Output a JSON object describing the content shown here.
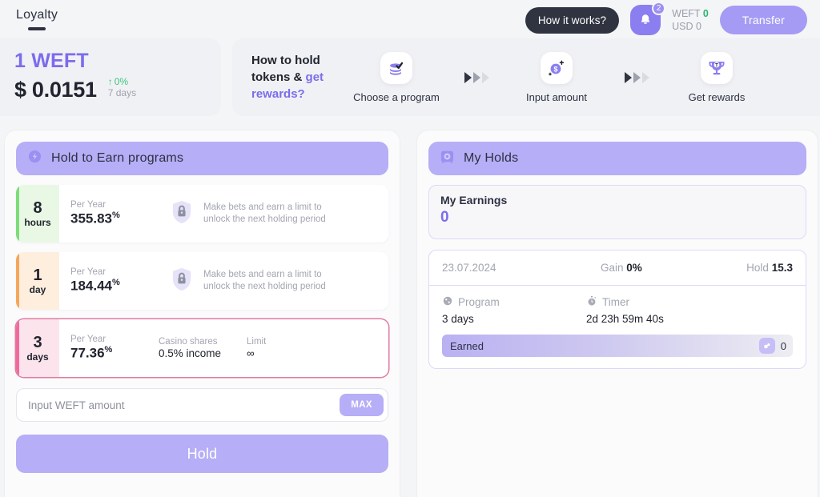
{
  "header": {
    "nav_tab": "Loyalty",
    "how_it_works": "How it works?",
    "notification_count": "2",
    "balance_weft_label": "WEFT",
    "balance_weft_value": "0",
    "balance_usd_label": "USD",
    "balance_usd_value": "0",
    "transfer_label": "Transfer"
  },
  "price_card": {
    "token": "1 WEFT",
    "currency_symbol": "$",
    "price": "0.0151",
    "delta": "0%",
    "delta_period": "7 days",
    "delta_color": "#3dc47e"
  },
  "steps": {
    "title_line1": "How to hold",
    "title_line2": "tokens &",
    "title_accent1": "get",
    "title_accent2": "rewards?",
    "items": [
      {
        "label": "Choose a program",
        "icon": "coins-stack-check-icon"
      },
      {
        "label": "Input amount",
        "icon": "dollar-coin-icon"
      },
      {
        "label": "Get rewards",
        "icon": "trophy-icon"
      }
    ]
  },
  "left_panel": {
    "title": "Hold to Earn programs",
    "icon": "lightning-badge-icon",
    "programs": [
      {
        "num": "8",
        "unit": "hours",
        "accent": "#7ddc7a",
        "badge_bg": "#e9f8e4",
        "per_year_label": "Per Year",
        "per_year_value": "355.83",
        "per_year_suffix": "%",
        "locked": true,
        "lock_note": "Make bets and earn a limit to unlock the next holding period",
        "selected": false
      },
      {
        "num": "1",
        "unit": "day",
        "accent": "#f5a65b",
        "badge_bg": "#fdeedd",
        "per_year_label": "Per Year",
        "per_year_value": "184.44",
        "per_year_suffix": "%",
        "locked": true,
        "lock_note": "Make bets and earn a limit to unlock the next holding period",
        "selected": false
      },
      {
        "num": "3",
        "unit": "days",
        "accent": "#f06b9b",
        "badge_bg": "#fce4ec",
        "per_year_label": "Per Year",
        "per_year_value": "77.36",
        "per_year_suffix": "%",
        "locked": false,
        "shares_label": "Casino shares",
        "shares_value": "0.5% income",
        "limit_label": "Limit",
        "limit_value": "∞",
        "selected": true
      }
    ],
    "amount_placeholder": "Input WEFT amount",
    "amount_value": "",
    "max_label": "MAX",
    "hold_label": "Hold"
  },
  "right_panel": {
    "title": "My Holds",
    "icon": "safe-vault-icon",
    "earnings_label": "My Earnings",
    "earnings_value": "0",
    "hold": {
      "date": "23.07.2024",
      "gain_label": "Gain",
      "gain_value": "0%",
      "hold_label": "Hold",
      "hold_value": "15.3",
      "program_label": "Program",
      "program_value": "3 days",
      "timer_label": "Timer",
      "timer_value": "2d 23h 59m 40s",
      "earned_label": "Earned",
      "earned_value": "0"
    }
  },
  "colors": {
    "accent": "#7b6ced",
    "panel_head": "#b6aef6",
    "dark": "#2f3440"
  }
}
